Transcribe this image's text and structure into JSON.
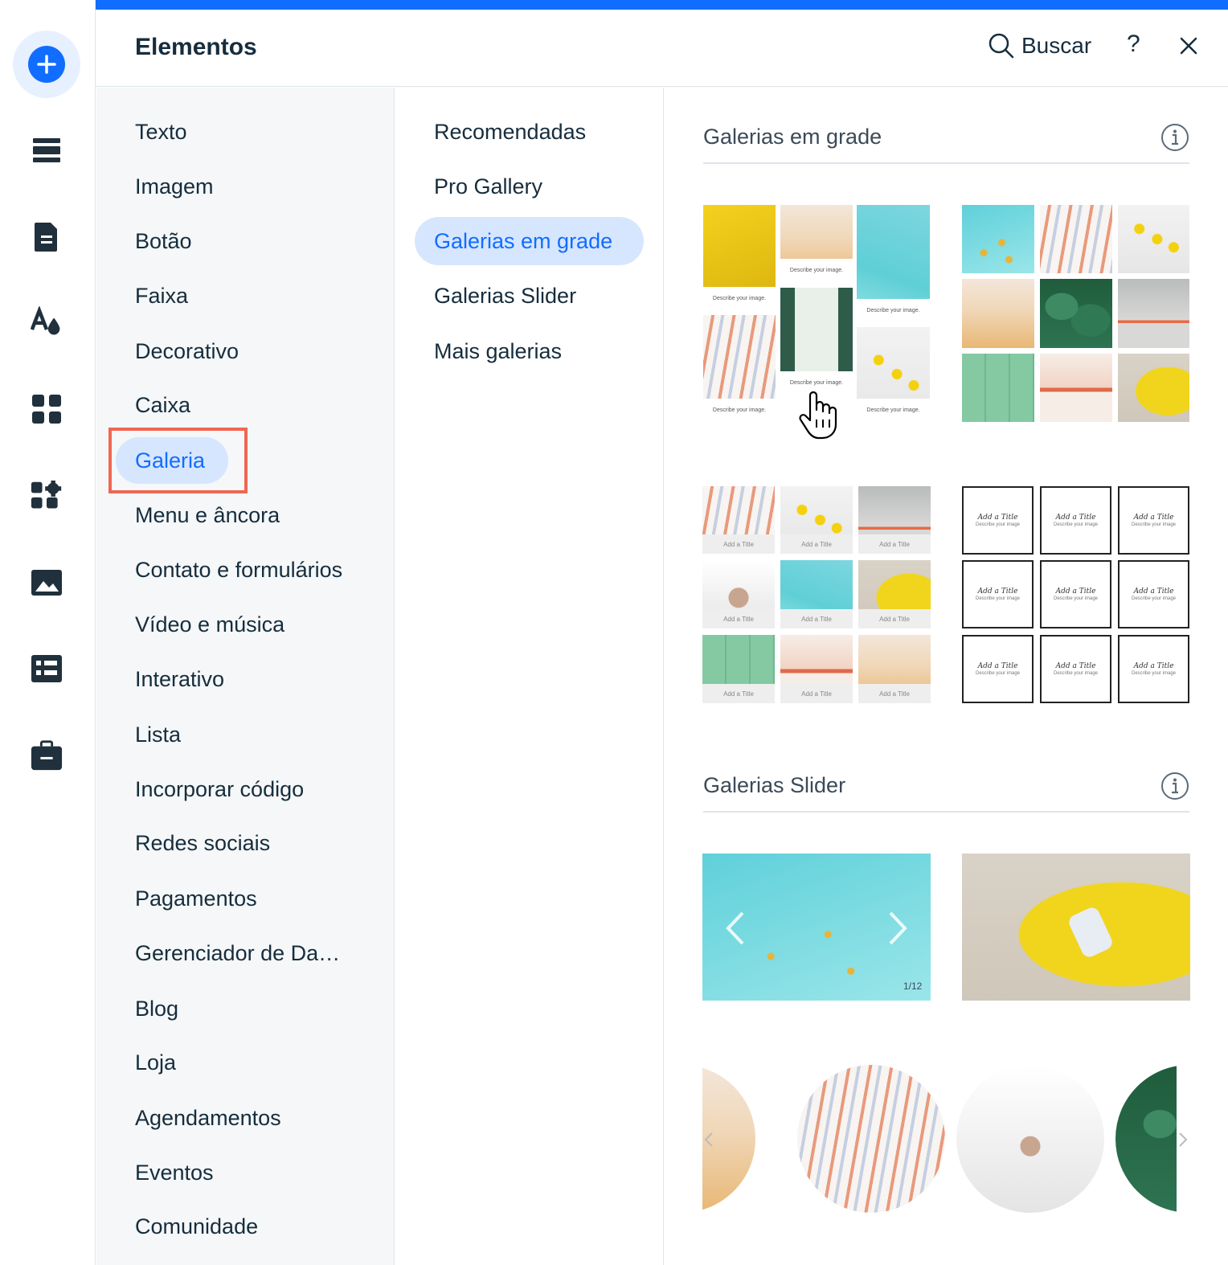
{
  "header": {
    "title": "Elementos",
    "search_label": "Buscar",
    "help_label": "?"
  },
  "rail": {
    "icons": [
      "add-icon",
      "sections-icon",
      "pages-icon",
      "theme-icon",
      "apps-icon",
      "app-market-icon",
      "media-icon",
      "cms-icon",
      "business-icon"
    ]
  },
  "categories": [
    "Texto",
    "Imagem",
    "Botão",
    "Faixa",
    "Decorativo",
    "Caixa",
    "Galeria",
    "Menu e âncora",
    "Contato e formulários",
    "Vídeo e música",
    "Interativo",
    "Lista",
    "Incorporar código",
    "Redes sociais",
    "Pagamentos",
    "Gerenciador de Da…",
    "Blog",
    "Loja",
    "Agendamentos",
    "Eventos",
    "Comunidade"
  ],
  "active_category": "Galeria",
  "subcategories": [
    "Recomendadas",
    "Pro Gallery",
    "Galerias em grade",
    "Galerias Slider",
    "Mais galerias"
  ],
  "active_subcategory": "Galerias em grade",
  "sections": {
    "grid": {
      "title": "Galerias em grade",
      "caption_describe": "Describe your image.",
      "caption_add_title": "Add a Title",
      "title_card_title": "Add a Title",
      "title_card_desc": "Describe your image"
    },
    "slider": {
      "title": "Galerias Slider",
      "counter": "1/12"
    }
  },
  "colors": {
    "accent": "#116dff",
    "active_pill": "#d6e6fe",
    "highlight_border": "#f06652"
  }
}
